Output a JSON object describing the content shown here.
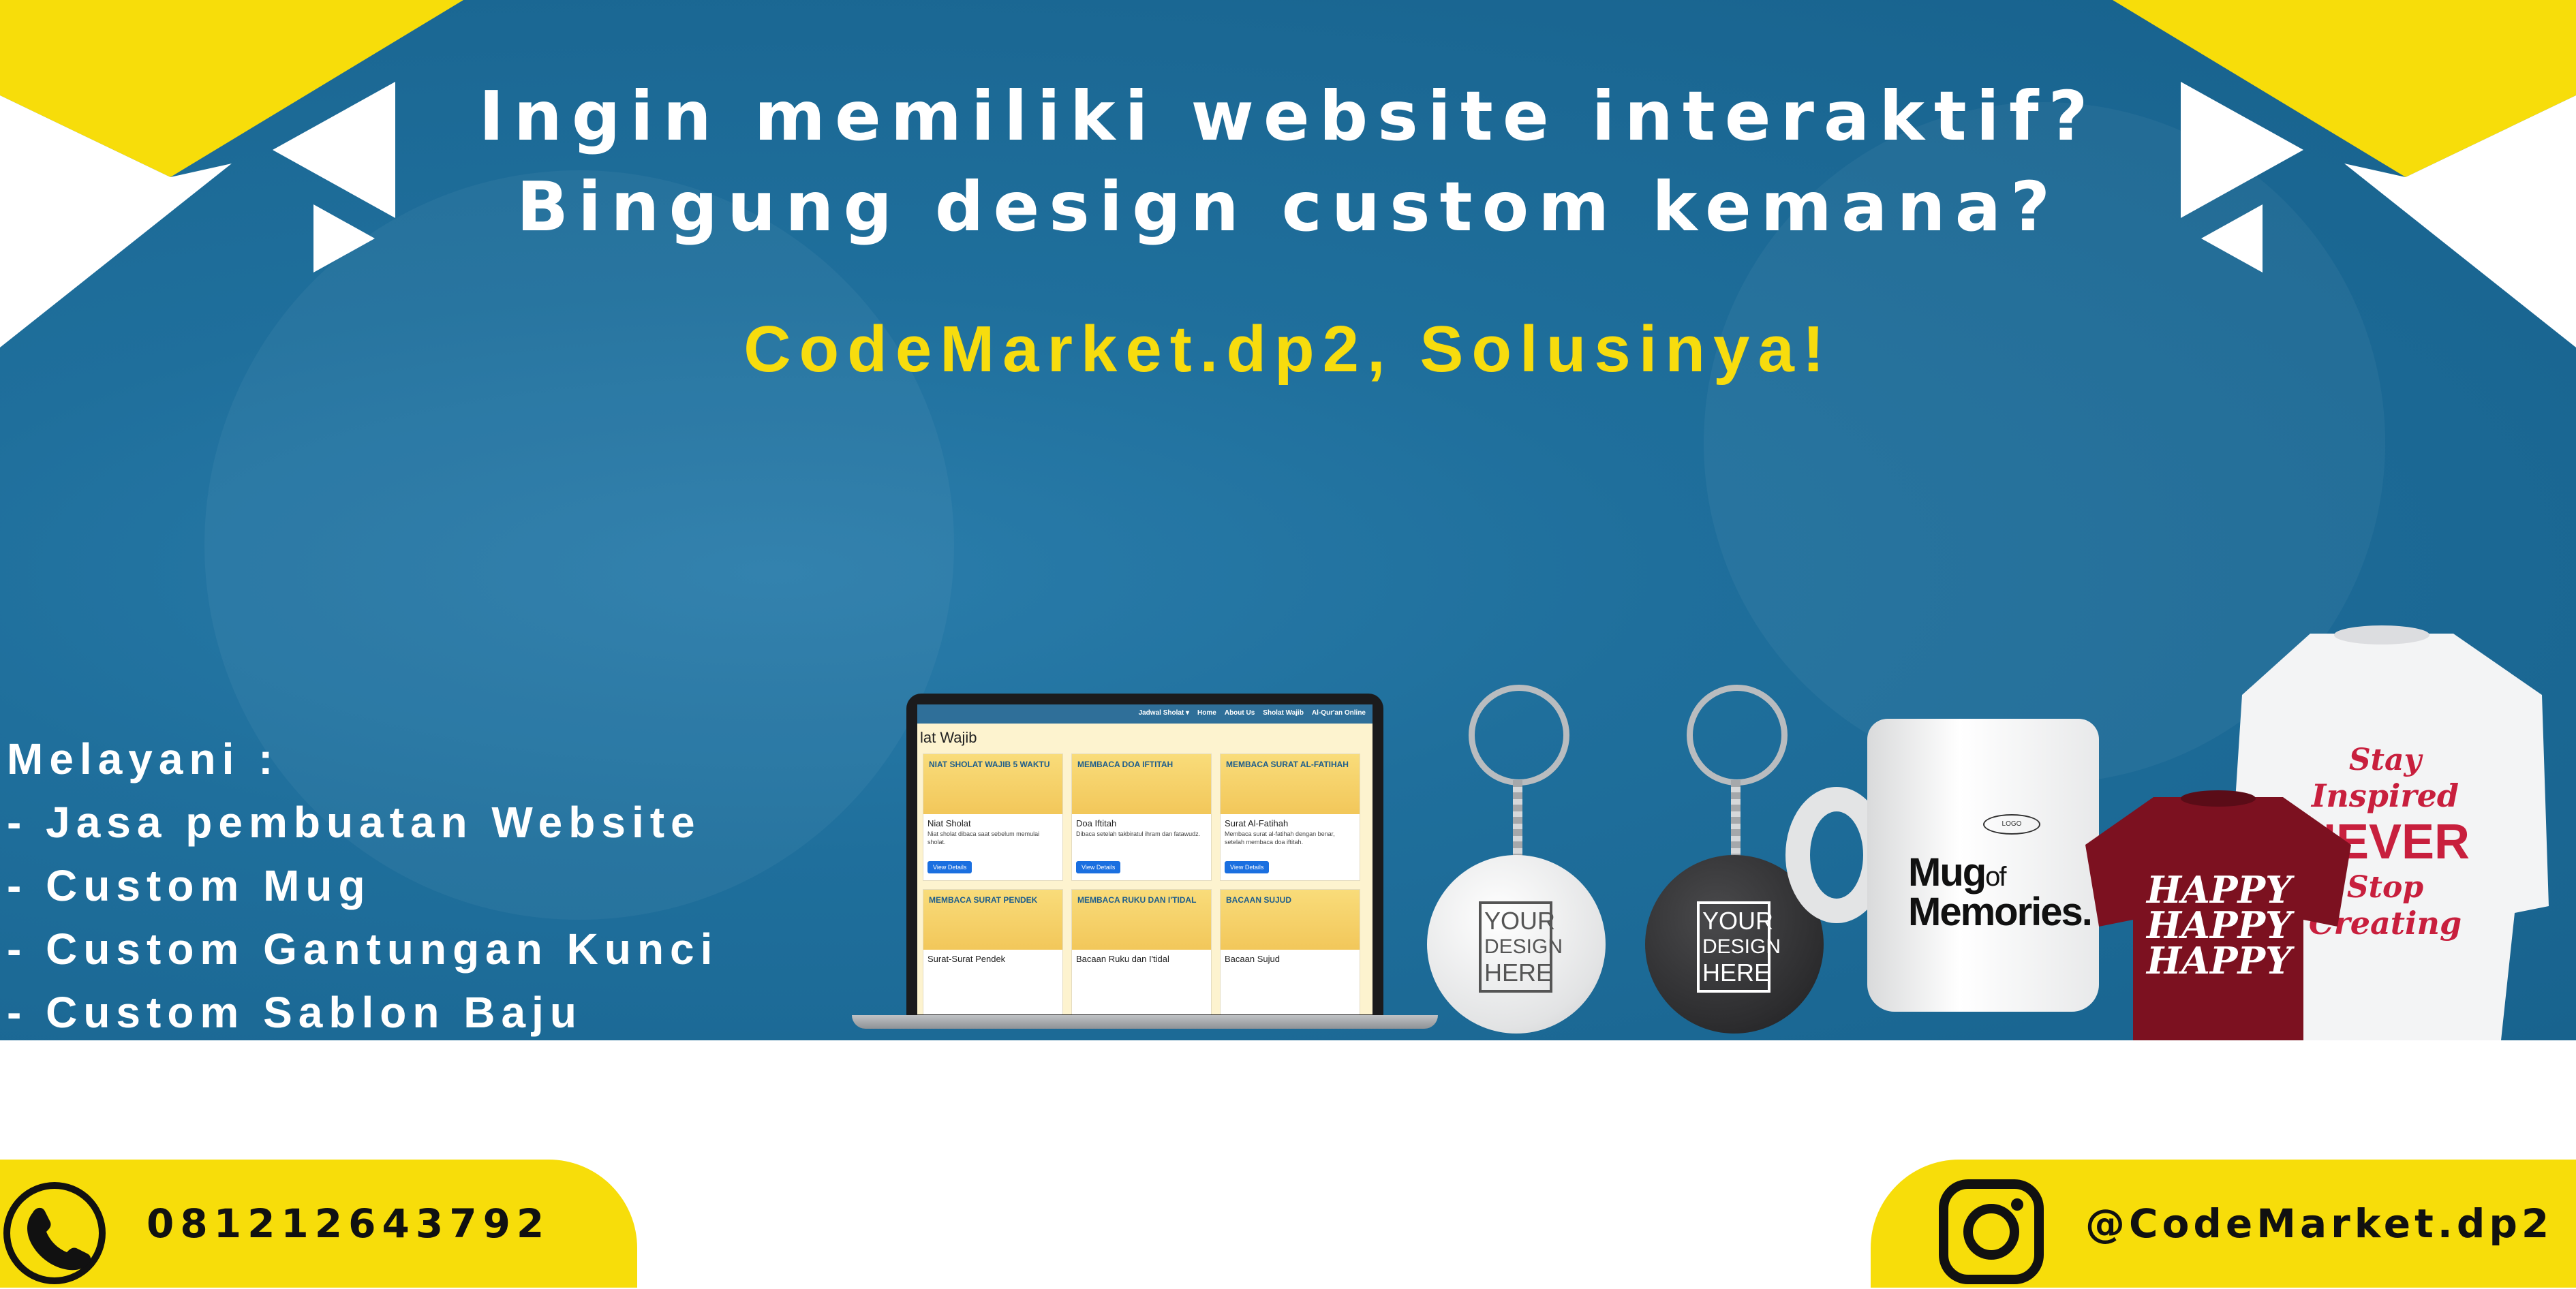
{
  "headline": {
    "line1": "Ingin memiliki website interaktif?",
    "line2": "Bingung design custom kemana?"
  },
  "brand_line": "CodeMarket.dp2, Solusinya!",
  "services": {
    "title": "Melayani :",
    "items": [
      "- Jasa pembuatan Website",
      "- Custom Mug",
      "- Custom Gantungan Kunci",
      "- Custom Sablon Baju"
    ]
  },
  "laptop_site": {
    "nav_links": [
      "Jadwal Sholat ▾",
      "Home",
      "About Us",
      "Sholat Wajib",
      "Al-Qur'an Online"
    ],
    "heading": "lat Wajib",
    "cards": [
      {
        "tag": "NIAT SHOLAT WAJIB 5 WAKTU",
        "title": "Niat Sholat",
        "text": "Niat sholat dibaca saat sebelum memulai sholat.",
        "button": "View Details"
      },
      {
        "tag": "MEMBACA DOA IFTITAH",
        "title": "Doa Iftitah",
        "text": "Dibaca setelah takbiratul ihram dan fatawudz.",
        "button": "View Details"
      },
      {
        "tag": "MEMBACA SURAT AL-FATIHAH",
        "title": "Surat Al-Fatihah",
        "text": "Membaca surat al-fatihah dengan benar, setelah membaca doa iftitah.",
        "button": "View Details"
      },
      {
        "tag": "MEMBACA SURAT PENDEK",
        "title": "Surat-Surat Pendek",
        "text": "",
        "button": ""
      },
      {
        "tag": "MEMBACA RUKU DAN I'TIDAL",
        "title": "Bacaan Ruku dan I'tidal",
        "text": "",
        "button": ""
      },
      {
        "tag": "BACAAN SUJUD",
        "title": "Bacaan Sujud",
        "text": "",
        "button": ""
      }
    ]
  },
  "keychain_label": [
    "YOUR",
    "DESIGN",
    "HERE"
  ],
  "mug": {
    "badge": "LOGO",
    "title_line1": "Mug",
    "title_of": "of",
    "title_line2": "Memories."
  },
  "shirt_red_text": [
    "HAPPY",
    "HAPPY",
    "HAPPY"
  ],
  "shirt_white_text": [
    "Stay",
    "Inspired",
    "NEVER",
    "Stop",
    "Creating"
  ],
  "contact": {
    "phone": "081212643792",
    "instagram": "@CodeMarket.dp2"
  },
  "colors": {
    "banner_blue": "#1f6f9c",
    "accent_yellow": "#f7dc0e",
    "white": "#ffffff"
  },
  "icons": [
    "phone-icon",
    "instagram-icon"
  ]
}
